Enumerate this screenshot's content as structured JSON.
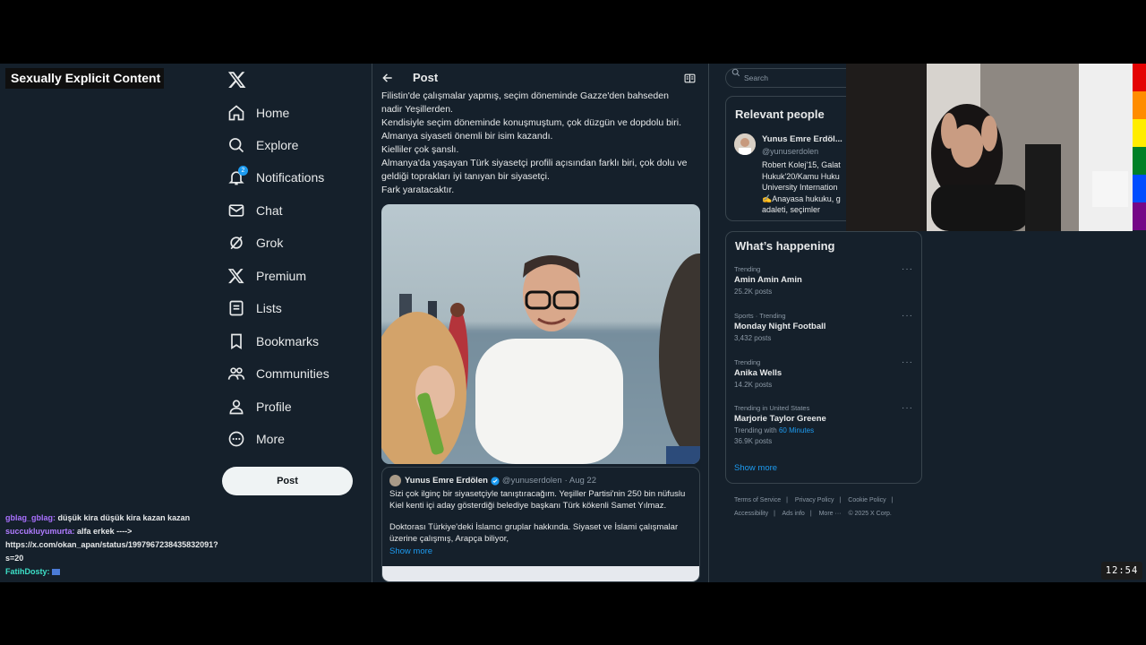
{
  "overlay": {
    "warning": "Sexually Explicit Content",
    "chat": [
      {
        "user": "gblag_gblag:",
        "message": "düşük kira düşük kira kazan kazan",
        "color": "#a970ff"
      },
      {
        "user": "succukluyumurta:",
        "message": "alfa erkek ----> https://x.com/okan_apan/status/1997967238435832091?s=20",
        "color": "#b07cff"
      },
      {
        "user": "FatihDosty:",
        "message": "",
        "color": "#3de0c8"
      }
    ],
    "clock": "12:54"
  },
  "nav": {
    "items": [
      {
        "label": "Home",
        "icon": "home-icon"
      },
      {
        "label": "Explore",
        "icon": "search-icon"
      },
      {
        "label": "Notifications",
        "icon": "bell-icon",
        "badge": "2"
      },
      {
        "label": "Chat",
        "icon": "mail-icon"
      },
      {
        "label": "Grok",
        "icon": "grok-icon"
      },
      {
        "label": "Premium",
        "icon": "x-icon"
      },
      {
        "label": "Lists",
        "icon": "list-icon"
      },
      {
        "label": "Bookmarks",
        "icon": "bookmark-icon"
      },
      {
        "label": "Communities",
        "icon": "people-icon"
      },
      {
        "label": "Profile",
        "icon": "person-icon"
      },
      {
        "label": "More",
        "icon": "more-circle-icon"
      }
    ],
    "post_button": "Post"
  },
  "center": {
    "title": "Post",
    "text_lines": [
      "Filistin'de çalışmalar yapmış, seçim döneminde Gazze'den bahseden",
      "nadir Yeşillerden.",
      "Kendisiyle seçim döneminde konuşmuştum, çok düzgün ve dopdolu biri.",
      "Almanya siyaseti önemli bir isim kazandı.",
      "Kielliler çok şanslı.",
      "Almanya'da yaşayan Türk siyasetçi profili açısından farklı biri, çok dolu ve",
      "geldiği toprakları iyi tanıyan bir siyasetçi.",
      "Fark yaratacaktır."
    ],
    "quote": {
      "name": "Yunus Emre Erdölen",
      "handle": "@yunuserdolen",
      "date": "· Aug 22",
      "text1": "Sizi çok ilginç bir siyasetçiyle tanıştıracağım. Yeşiller Partisi'nin 250 bin nüfuslu Kiel kenti içi aday gösterdiği belediye başkanı Türk kökenli Samet Yılmaz.",
      "text2": "Doktorası Türkiye'deki İslamcı gruplar hakkında. Siyaset ve İslami çalışmalar üzerine çalışmış, Arapça biliyor,",
      "show_more": "Show more"
    }
  },
  "right": {
    "search_placeholder": "Search",
    "relevant": {
      "title": "Relevant people",
      "name": "Yunus Emre Erdöl...",
      "handle": "@yunuserdolen",
      "bio": [
        "Robert Kolej'15, Galat",
        "Hukuk'20/Kamu Huku",
        "University Internation",
        "✍️Anayasa hukuku, g",
        "adaleti, seçimler"
      ]
    },
    "happening": {
      "title": "What’s happening",
      "trends": [
        {
          "context": "Trending",
          "name": "Amin Amin Amin",
          "posts": "25.2K posts"
        },
        {
          "context": "Sports · Trending",
          "name": "Monday Night Football",
          "posts": "3,432 posts"
        },
        {
          "context": "Trending",
          "name": "Anika Wells",
          "posts": "14.2K posts"
        },
        {
          "context": "Trending in United States",
          "name": "Marjorie Taylor Greene",
          "with_label": "Trending with",
          "with_link": "60 Minutes",
          "posts": "36.9K posts"
        }
      ],
      "show_more": "Show more"
    },
    "footer": {
      "links": [
        "Terms of Service",
        "|",
        "Privacy Policy",
        "|",
        "Cookie Policy",
        "|"
      ],
      "links2": [
        "Accessibility",
        "|",
        "Ads info",
        "|",
        "More ···",
        "© 2025 X Corp."
      ]
    }
  },
  "colors": {
    "background": "#15202b",
    "accent": "#1d9bf0",
    "border": "#38444d",
    "pride_stripes": [
      "#e40303",
      "#ff8c00",
      "#ffed00",
      "#008026",
      "#004dff",
      "#750787"
    ]
  }
}
